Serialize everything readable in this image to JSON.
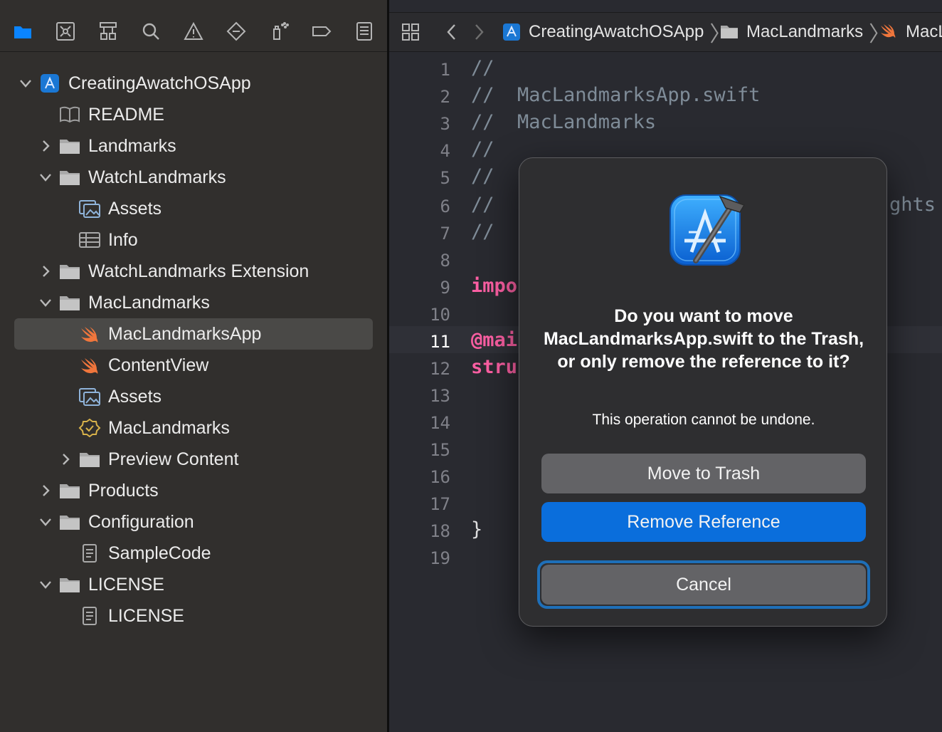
{
  "navigator": {
    "toolbar_tabs": [
      {
        "icon": "folder-icon",
        "active": true
      },
      {
        "icon": "source-control-icon"
      },
      {
        "icon": "symbol-hierarchy-icon"
      },
      {
        "icon": "search-icon"
      },
      {
        "icon": "warning-icon"
      },
      {
        "icon": "test-diamond-icon"
      },
      {
        "icon": "debug-spray-icon"
      },
      {
        "icon": "breakpoint-icon"
      },
      {
        "icon": "report-icon"
      }
    ],
    "tree": [
      {
        "label": "CreatingAwatchOSApp",
        "icon": "project-icon",
        "disclosure": "open",
        "level": 0
      },
      {
        "label": "README",
        "icon": "book-icon",
        "disclosure": "none",
        "level": 1
      },
      {
        "label": "Landmarks",
        "icon": "folder-icon",
        "disclosure": "closed",
        "level": 1
      },
      {
        "label": "WatchLandmarks",
        "icon": "folder-icon",
        "disclosure": "open",
        "level": 1
      },
      {
        "label": "Assets",
        "icon": "asset-catalog-icon",
        "disclosure": "none",
        "level": 2
      },
      {
        "label": "Info",
        "icon": "plist-table-icon",
        "disclosure": "none",
        "level": 2
      },
      {
        "label": "WatchLandmarks Extension",
        "icon": "folder-icon",
        "disclosure": "closed",
        "level": 1
      },
      {
        "label": "MacLandmarks",
        "icon": "folder-icon",
        "disclosure": "open",
        "level": 1
      },
      {
        "label": "MacLandmarksApp",
        "icon": "swift-icon",
        "disclosure": "none",
        "level": 2,
        "selected": true
      },
      {
        "label": "ContentView",
        "icon": "swift-icon",
        "disclosure": "none",
        "level": 2
      },
      {
        "label": "Assets",
        "icon": "asset-catalog-icon",
        "disclosure": "none",
        "level": 2
      },
      {
        "label": "MacLandmarks",
        "icon": "entitlements-badge-icon",
        "disclosure": "none",
        "level": 2
      },
      {
        "label": "Preview Content",
        "icon": "folder-icon",
        "disclosure": "closed",
        "level": 2
      },
      {
        "label": "Products",
        "icon": "folder-icon",
        "disclosure": "closed",
        "level": 1
      },
      {
        "label": "Configuration",
        "icon": "folder-icon",
        "disclosure": "open",
        "level": 1
      },
      {
        "label": "SampleCode",
        "icon": "document-icon",
        "disclosure": "none",
        "level": 2
      },
      {
        "label": "LICENSE",
        "icon": "folder-icon",
        "disclosure": "open",
        "level": 1
      },
      {
        "label": "LICENSE",
        "icon": "document-icon",
        "disclosure": "none",
        "level": 2
      }
    ]
  },
  "editor": {
    "jumpbar": {
      "project": "CreatingAwatchOSApp",
      "group": "MacLandmarks",
      "file": "MacL"
    },
    "line_numbers": [
      "1",
      "2",
      "3",
      "4",
      "5",
      "6",
      "7",
      "8",
      "9",
      "10",
      "11",
      "12",
      "13",
      "14",
      "15",
      "16",
      "17",
      "18",
      "19"
    ],
    "current_line": "11",
    "code": {
      "l1": "//",
      "l2": "//  MacLandmarksApp.swift",
      "l3": "//  MacLandmarks",
      "l4": "//",
      "l5": "//",
      "l6": "//",
      "l6_tail": "ghts",
      "l7": "//",
      "l9": "impo",
      "l11": "@mai",
      "l12": "stru",
      "l18": "}"
    }
  },
  "dialog": {
    "icon": "xcode-app-icon",
    "title": "Do you want to move MacLandmarksApp.swift to the Trash, or only remove the reference to it?",
    "message": "This operation cannot be undone.",
    "buttons": {
      "trash": "Move to Trash",
      "remove": "Remove Reference",
      "cancel": "Cancel"
    }
  },
  "colors": {
    "accent": "#0a6edc",
    "navigator_bg": "#312f2d",
    "editor_bg": "#292a30",
    "keyword": "#fc5fa3",
    "comment": "#7f8c98"
  }
}
